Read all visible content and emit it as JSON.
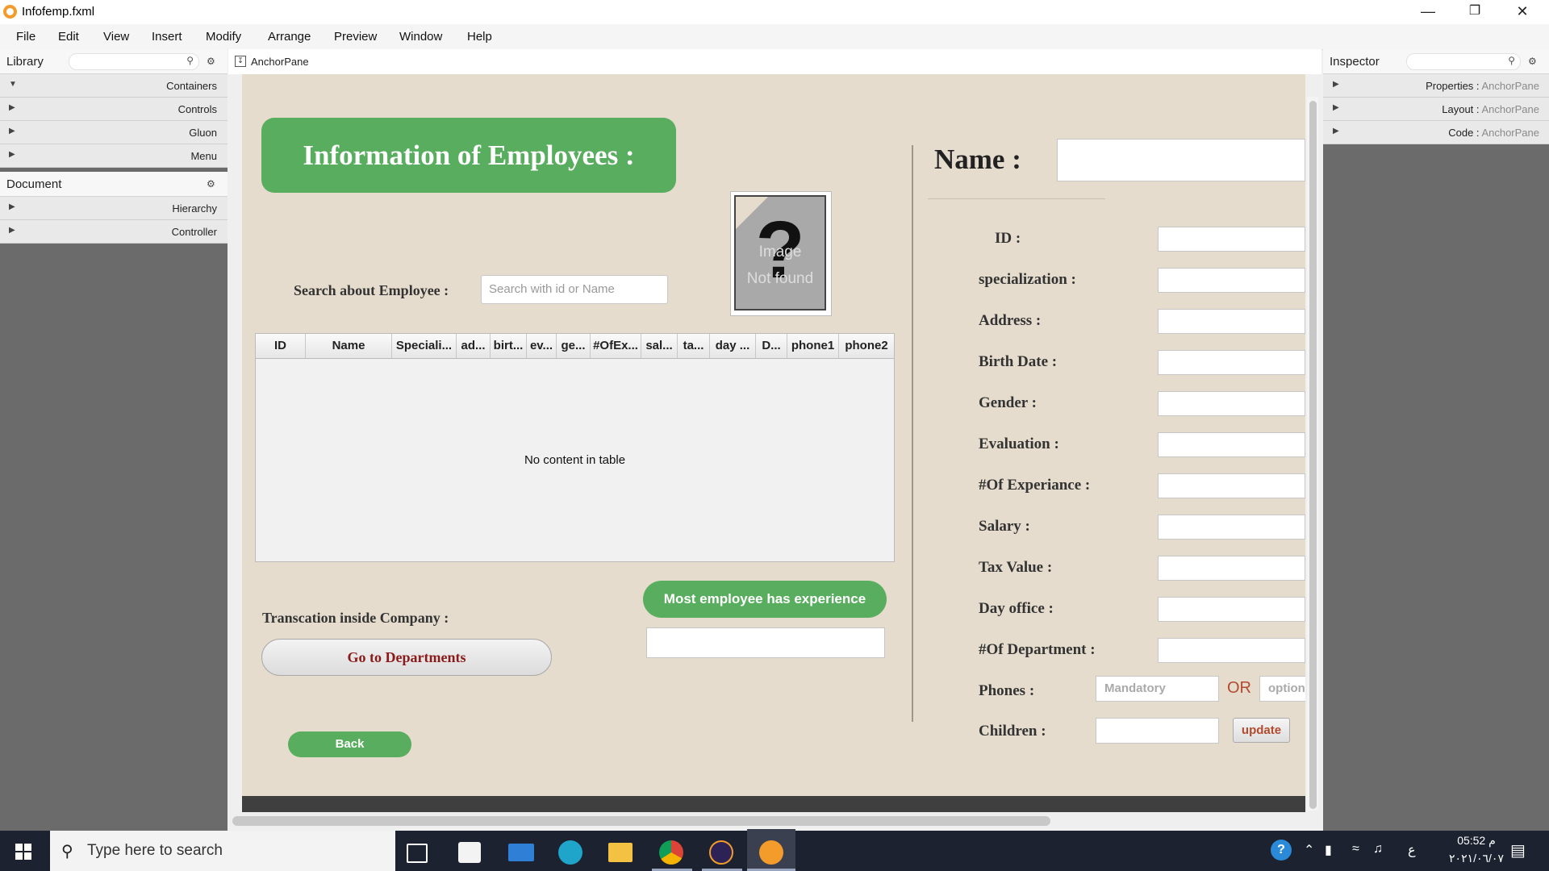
{
  "window": {
    "title": "Infofemp.fxml",
    "minimize_glyph": "—",
    "maximize_glyph": "❐",
    "close_glyph": "✕"
  },
  "menubar": {
    "items": [
      "File",
      "Edit",
      "View",
      "Insert",
      "Modify",
      "Arrange",
      "Preview",
      "Window",
      "Help"
    ]
  },
  "library": {
    "title": "Library",
    "sections": [
      "Containers",
      "Controls",
      "Gluon",
      "Menu"
    ]
  },
  "document": {
    "title": "Document",
    "sections": [
      "Hierarchy",
      "Controller"
    ]
  },
  "center": {
    "header_label": "AnchorPane",
    "header_icon": "anchor-pane-icon"
  },
  "inspector": {
    "title": "Inspector",
    "sections": [
      {
        "label": "Properties",
        "sub": "AnchorPane"
      },
      {
        "label": "Layout",
        "sub": "AnchorPane"
      },
      {
        "label": "Code",
        "sub": "AnchorPane"
      }
    ],
    "separator": " : "
  },
  "form": {
    "title": "Information of Employees :",
    "image_text_1": "Image",
    "image_text_2": "Not found",
    "search_label": "Search about Employee :",
    "search_placeholder": "Search with id or Name",
    "table_columns": [
      "ID",
      "Name",
      "Speciali...",
      "ad...",
      "birt...",
      "ev...",
      "ge...",
      "#OfEx...",
      "sal...",
      "ta...",
      "day ...",
      "D...",
      "phone1",
      "phone2"
    ],
    "table_empty": "No content in table",
    "transaction_label": "Transcation inside Company :",
    "go_departments": "Go to Departments",
    "back": "Back",
    "most_experience": "Most employee has experience",
    "name_label": "Name :",
    "fields": [
      "ID :",
      "specialization :",
      "Address :",
      "Birth Date :",
      "Gender :",
      "Evaluation :",
      "#Of Experiance :",
      "Salary :",
      "Tax Value :",
      "Day office :",
      "#Of Department :"
    ],
    "phones_label": "Phones :",
    "phone1_placeholder": "Mandatory",
    "or_label": "OR",
    "phone2_placeholder": "optional",
    "children_label": "Children :",
    "update": "update"
  },
  "colors": {
    "green": "#59ad5e",
    "pane_bg": "#e5dccd",
    "dark_red": "#8b1a1a",
    "orange_red": "#b24a2e"
  },
  "taskbar": {
    "search_text": "Type here to search",
    "time": "05:52 م",
    "date": "٢٠٢١/٠٦/٠٧",
    "lang": "ع",
    "icons": [
      "task-view-icon",
      "store-icon",
      "mail-icon",
      "edge-icon",
      "file-explorer-icon",
      "chrome-icon",
      "eclipse-icon",
      "scene-builder-icon"
    ]
  }
}
